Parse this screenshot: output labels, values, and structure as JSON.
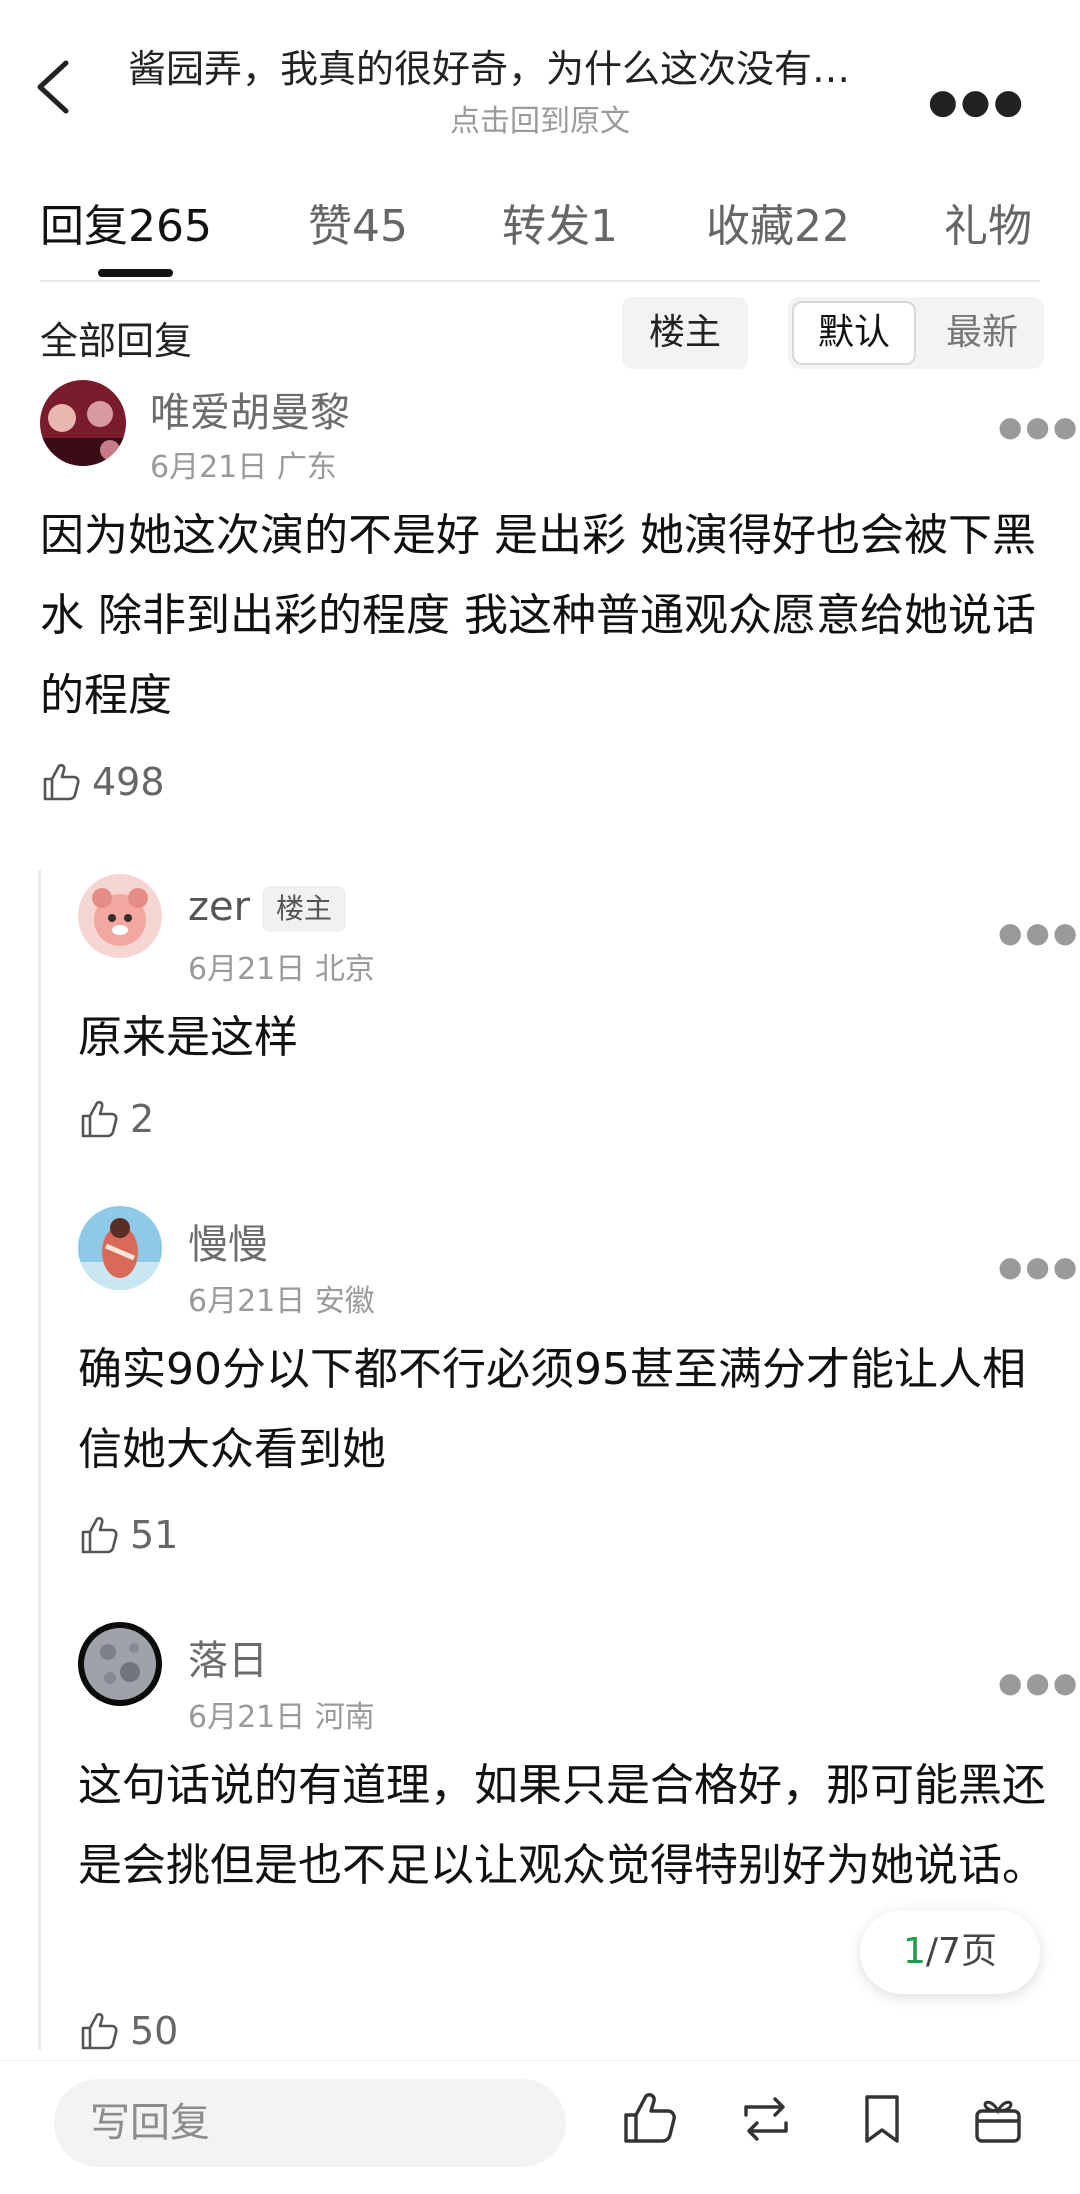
{
  "header": {
    "title": "酱园弄，我真的很好奇，为什么这次没有…",
    "subtitle": "点击回到原文"
  },
  "tabs": [
    {
      "label": "回复",
      "count": "265"
    },
    {
      "label": "赞",
      "count": "45"
    },
    {
      "label": "转发",
      "count": "1"
    },
    {
      "label": "收藏",
      "count": "22"
    },
    {
      "label": "礼物",
      "count": ""
    }
  ],
  "filter": {
    "all_replies": "全部回复",
    "op_only": "楼主",
    "sort_default": "默认",
    "sort_latest": "最新"
  },
  "comments": [
    {
      "username": "唯爱胡曼黎",
      "date": "6月21日",
      "location": "广东",
      "text": "因为她这次演的不是好  是出彩  她演得好也会被下黑水  除非到出彩的程度   我这种普通观众愿意给她说话的程度",
      "likes": "498"
    }
  ],
  "replies": [
    {
      "username": "zer",
      "badge": "楼主",
      "date": "6月21日",
      "location": "北京",
      "text": "原来是这样",
      "likes": "2"
    },
    {
      "username": "慢慢",
      "date": "6月21日",
      "location": "安徽",
      "text": "确实90分以下都不行必须95甚至满分才能让人相信她大众看到她",
      "likes": "51"
    },
    {
      "username": "落日",
      "date": "6月21日",
      "location": "河南",
      "text": "这句话说的有道理，如果只是合格好，那可能黑还是会挑但是也不足以让观众觉得特别好为她说话。",
      "likes": "50"
    }
  ],
  "pagination": {
    "current": "1",
    "total": "/7页"
  },
  "bottom_bar": {
    "reply_placeholder": "写回复"
  },
  "colors": {
    "accent_green": "#1a9e4a",
    "text_grey": "#9a9a9a"
  }
}
